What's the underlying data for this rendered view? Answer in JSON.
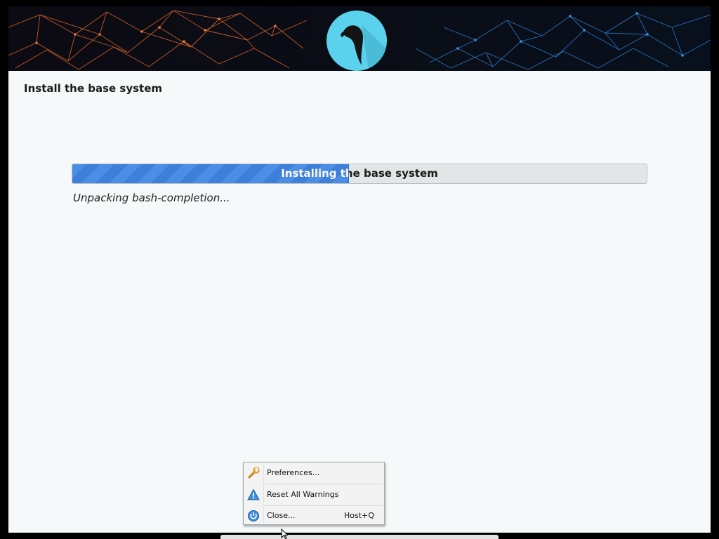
{
  "installer": {
    "page_title": "Install the base system",
    "progress": {
      "label": "Installing the base system",
      "fraction": 0.48
    },
    "status_text": "Unpacking bash-completion..."
  },
  "banner": {
    "logo_icon": "parrot-logo-icon",
    "logo_color": "#5ad2ee"
  },
  "context_menu": {
    "items": [
      {
        "label": "Preferences...",
        "icon": "wrench-icon",
        "shortcut": ""
      },
      {
        "label": "Reset All Warnings",
        "icon": "warning-icon",
        "shortcut": ""
      },
      {
        "label": "Close...",
        "icon": "power-icon",
        "shortcut": "Host+Q"
      }
    ]
  },
  "colors": {
    "progress_fill": "#4a8ee6",
    "background": "#f5f9f9"
  }
}
